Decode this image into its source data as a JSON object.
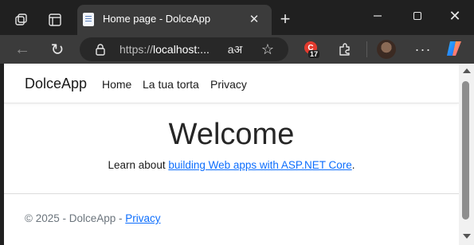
{
  "browser": {
    "tab": {
      "title": "Home page - DolceApp",
      "favicon": "page-icon"
    },
    "icons": {
      "workspaces": "workspaces-icon",
      "tab_actions": "tab-actions-icon",
      "close_tab": "close-icon",
      "new_tab": "plus-icon",
      "minimize": "minimize-icon",
      "maximize": "maximize-icon",
      "close_window": "close-icon"
    },
    "toolbar": {
      "url_scheme": "https://",
      "url_host": "localhost:...",
      "extension_badge_letter": "C",
      "extension_badge_count": "17",
      "more_label": "···"
    }
  },
  "page": {
    "brand": "DolceApp",
    "nav": [
      {
        "label": "Home"
      },
      {
        "label": "La tua torta"
      },
      {
        "label": "Privacy"
      }
    ],
    "title": "Welcome",
    "lead_prefix": "Learn about ",
    "lead_link": "building Web apps with ASP.NET Core",
    "lead_suffix": ".",
    "footer_text": "© 2025 - DolceApp - ",
    "footer_link": "Privacy"
  },
  "colors": {
    "link": "#0d6efd",
    "browser_dark": "#202020",
    "toolbar": "#3b3b3b"
  }
}
